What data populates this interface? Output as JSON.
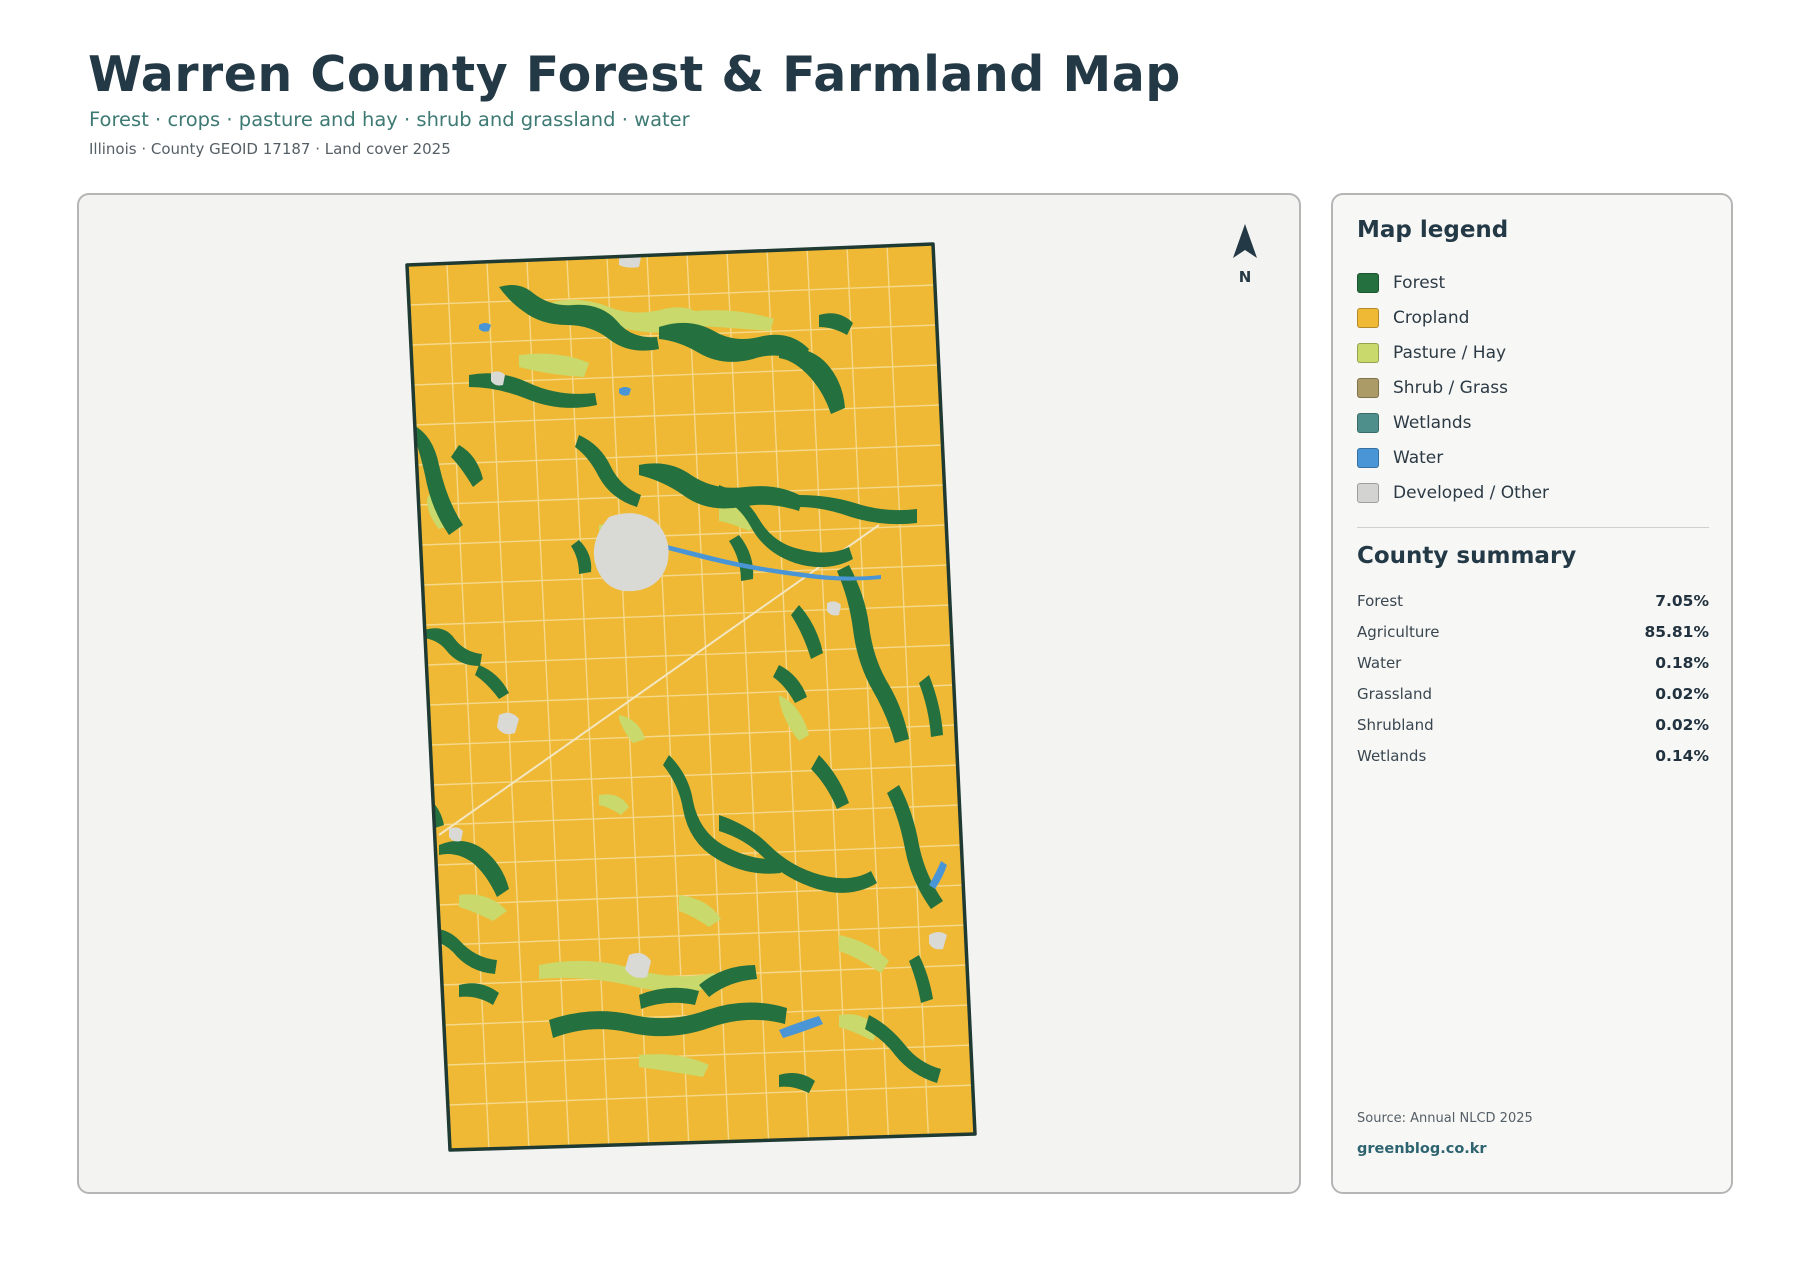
{
  "header": {
    "title": "Warren County Forest & Farmland Map",
    "subtitle": "Forest · crops · pasture and hay · shrub and grassland · water",
    "meta": "Illinois · County GEOID 17187 · Land cover 2025"
  },
  "map": {
    "north_label": "N",
    "colors": {
      "forest": "#25703f",
      "cropland": "#efb936",
      "pasture": "#c9d96b",
      "shrub": "#ab9b66",
      "wetlands": "#4e8f8c",
      "water": "#4a95d6",
      "developed": "#d9d9d6",
      "boundary": "#1f3a33"
    }
  },
  "legend": {
    "title": "Map legend",
    "items": [
      {
        "label": "Forest",
        "color": "#25703f"
      },
      {
        "label": "Cropland",
        "color": "#efb936"
      },
      {
        "label": "Pasture / Hay",
        "color": "#c9d96b"
      },
      {
        "label": "Shrub / Grass",
        "color": "#ab9b66"
      },
      {
        "label": "Wetlands",
        "color": "#4e8f8c"
      },
      {
        "label": "Water",
        "color": "#4a95d6"
      },
      {
        "label": "Developed / Other",
        "color": "#d3d3d1"
      }
    ]
  },
  "summary": {
    "title": "County summary",
    "rows": [
      {
        "label": "Forest",
        "value": "7.05%"
      },
      {
        "label": "Agriculture",
        "value": "85.81%"
      },
      {
        "label": "Water",
        "value": "0.18%"
      },
      {
        "label": "Grassland",
        "value": "0.02%"
      },
      {
        "label": "Shrubland",
        "value": "0.02%"
      },
      {
        "label": "Wetlands",
        "value": "0.14%"
      }
    ]
  },
  "footer": {
    "source": "Source: Annual NLCD 2025",
    "site": "greenblog.co.kr"
  }
}
